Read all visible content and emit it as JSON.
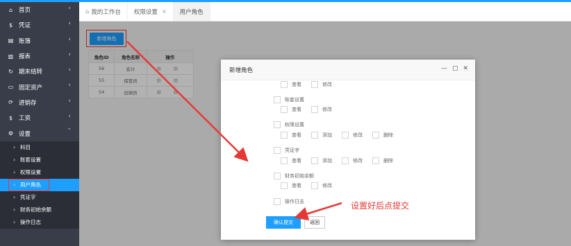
{
  "sidebar": {
    "items": [
      {
        "icon": "home-icon",
        "glyph": "⌂",
        "label": "首页"
      },
      {
        "icon": "dollar-icon",
        "glyph": "$",
        "label": "凭证"
      },
      {
        "icon": "ledger-icon",
        "glyph": "▤",
        "label": "账簿"
      },
      {
        "icon": "report-icon",
        "glyph": "▥",
        "label": "报表"
      },
      {
        "icon": "period-end-icon",
        "glyph": "↻",
        "label": "期末结转"
      },
      {
        "icon": "monitor-icon",
        "glyph": "▭",
        "label": "固定资产"
      },
      {
        "icon": "inventory-icon",
        "glyph": "⟳",
        "label": "进销存"
      },
      {
        "icon": "salary-icon",
        "glyph": "$",
        "label": "工资"
      },
      {
        "icon": "settings-icon",
        "glyph": "⚙",
        "label": "设置"
      }
    ],
    "sub_items": [
      {
        "label": "科目"
      },
      {
        "label": "账套设置"
      },
      {
        "label": "权限设置"
      },
      {
        "label": "用户角色"
      },
      {
        "label": "凭证字"
      },
      {
        "label": "财务初始余额"
      },
      {
        "label": "操作日志"
      }
    ]
  },
  "tabs": {
    "workbench": "我的工作台",
    "permission": "权限设置",
    "roles": "用户角色",
    "close_glyph": "×"
  },
  "content": {
    "add_button": "新增角色",
    "table": {
      "headers": [
        "角色ID",
        "角色名称",
        "操作"
      ],
      "rows": [
        {
          "id": "56",
          "name": "会计"
        },
        {
          "id": "55",
          "name": "保管员"
        },
        {
          "id": "54",
          "name": "出纳员"
        }
      ],
      "op_icons": "▤ ▤"
    }
  },
  "modal": {
    "title": "新增角色",
    "controls": {
      "minimize": "—",
      "maximize": "▢",
      "close": "✕"
    },
    "groups": [
      {
        "label": "",
        "actions": [
          "查看",
          "修改"
        ]
      },
      {
        "label": "账套设置",
        "actions": [
          "查看",
          "修改"
        ]
      },
      {
        "label": "权限设置",
        "actions": [
          "查看",
          "添加",
          "修改",
          "删除"
        ]
      },
      {
        "label": "凭证字",
        "actions": [
          "查看",
          "添加",
          "修改",
          "删除"
        ]
      },
      {
        "label": "财务初始余额",
        "actions": [
          "查看",
          "修改"
        ]
      },
      {
        "label": "操作日志",
        "actions": []
      }
    ],
    "submit": "确认提交",
    "back": "返回"
  },
  "annotation": "设置好后点提交",
  "colors": {
    "accent": "#1E9FFF",
    "sidebar": "#393D49",
    "highlight": "#e53935"
  }
}
